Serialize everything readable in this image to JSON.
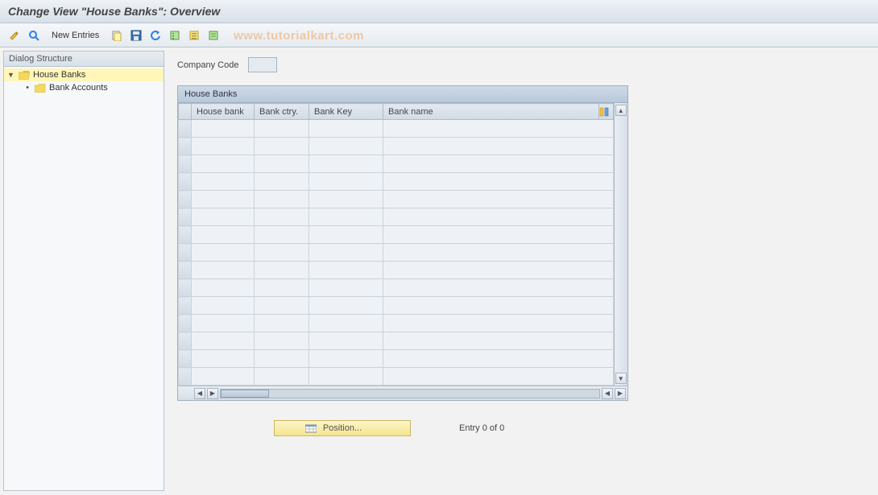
{
  "title": "Change View \"House Banks\": Overview",
  "toolbar": {
    "new_entries_label": "New Entries"
  },
  "watermark": "www.tutorialkart.com",
  "sidebar": {
    "header": "Dialog Structure",
    "items": [
      {
        "label": "House Banks",
        "selected": true,
        "open": true
      },
      {
        "label": "Bank Accounts",
        "selected": false,
        "open": false
      }
    ]
  },
  "form": {
    "company_code_label": "Company Code",
    "company_code_value": ""
  },
  "table": {
    "title": "House Banks",
    "columns": [
      "House bank",
      "Bank ctry.",
      "Bank Key",
      "Bank name"
    ],
    "rows_visible": 15
  },
  "footer": {
    "position_label": "Position...",
    "entry_status": "Entry 0 of 0"
  }
}
